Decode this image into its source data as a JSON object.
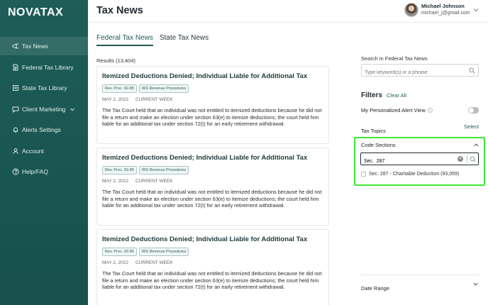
{
  "brand": {
    "logo_text": "NOVATAX"
  },
  "sidebar": {
    "items": [
      {
        "label": "Tax News",
        "icon": "megaphone-icon",
        "active": true
      },
      {
        "label": "Federal Tax Library",
        "icon": "document-icon"
      },
      {
        "label": "State Tax Library",
        "icon": "book-icon"
      },
      {
        "label": "Client Marketing",
        "icon": "chat-icon"
      },
      {
        "label": "Alerts Settings",
        "icon": "bell-icon"
      },
      {
        "label": "Account",
        "icon": "user-icon"
      },
      {
        "label": "Help/FAQ",
        "icon": "help-icon"
      }
    ]
  },
  "header": {
    "title": "Tax News",
    "user_name": "Michael Johnson",
    "user_email": "michael_j@gmail.com"
  },
  "tabs": [
    {
      "label": "Federal Tax News",
      "active": true
    },
    {
      "label": "State Tax News",
      "active": false
    }
  ],
  "results_text": "Results (13,404)",
  "articles": [
    {
      "title": "Itemized Deductions Denied; Individual Liable for Additional Tax",
      "tags": [
        "Rev. Proc. 92-85",
        "IRS Revenue Procedures"
      ],
      "date": "MAY 2, 2022",
      "period": "CURRENT WEEK",
      "summary": "The Tax Court held that an individual was not entitled to itemized deductions because he did not file a return and make an election under section 63(e) to itemize deductions; the court held him liable for an additional tax under section 72(t) for an early retirement withdrawal."
    },
    {
      "title": "Itemized Deductions Denied; Individual Liable for Additional Tax",
      "tags": [
        "Rev. Proc. 92-85",
        "IRS Revenue Procedures"
      ],
      "date": "MAY 2, 2022",
      "period": "CURRENT WEEK",
      "summary": "The Tax Court held that an individual was not entitled to itemized deductions because he did not file a return and make an election under section 63(e) to itemize deductions; the court held him liable for an additional tax under section 72(t) for an early retirement withdrawal."
    },
    {
      "title": "Itemized Deductions Denied; Individual Liable for Additional Tax",
      "tags": [
        "Rev. Proc. 92-85",
        "IRS Revenue Procedures"
      ],
      "date": "MAY 2, 2022",
      "period": "CURRENT WEEK",
      "summary": "The Tax Court held that an individual was not entitled to itemized deductions because he did not file a return and make an election under section 63(e) to itemize deductions; the court held him liable for an additional tax under section 72(t) for an early retirement withdrawal."
    }
  ],
  "search": {
    "label": "Search in Federal Tax News",
    "placeholder": "Type keyword(s) or a phrase"
  },
  "filters": {
    "title": "Filters",
    "clear_all": "Clear All",
    "alert_view_label": "My Personalized Alert View",
    "alert_view_on": false,
    "tax_topics_label": "Tax Topics",
    "tax_topics_action": "Select",
    "code_sections": {
      "title": "Code Sections",
      "input_value": "Sec.  287",
      "option_label": "Sec. 287 - Charitable Deduction (93,059)",
      "option_checked": false
    },
    "date_range_label": "Date Range"
  },
  "colors": {
    "sidebar_bg": "#1e5d58",
    "accent": "#1f5b57",
    "highlight_border": "#3fe83a"
  }
}
